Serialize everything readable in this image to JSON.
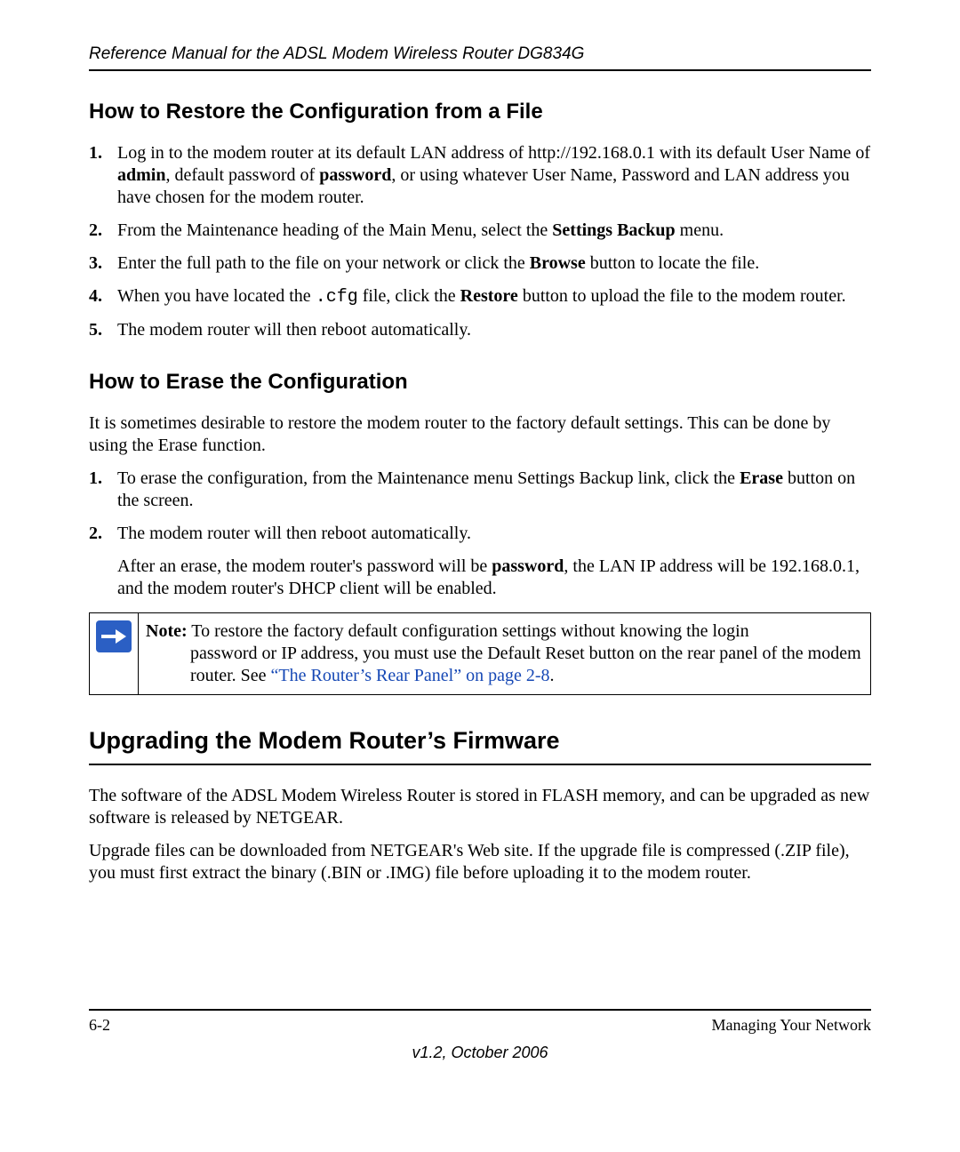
{
  "header": {
    "running_title": "Reference Manual for the ADSL Modem Wireless Router DG834G"
  },
  "section_restore": {
    "title": "How to Restore the Configuration from a File",
    "steps": [
      {
        "num": "1.",
        "pre": "Log in to the modem router at its default LAN address of http://192.168.0.1 with its default User Name of ",
        "b1": "admin",
        "mid": ", default password of ",
        "b2": "password",
        "post": ", or using whatever User Name, Password and LAN address you have chosen for the modem router."
      },
      {
        "num": "2.",
        "pre": "From the Maintenance heading of the Main Menu, select the ",
        "b1": "Settings Backup",
        "post": " menu."
      },
      {
        "num": "3.",
        "pre": "Enter the full path to the file on your network or click the ",
        "b1": "Browse",
        "post": " button to locate the file."
      },
      {
        "num": "4.",
        "pre": "When you have located the ",
        "mono": ".cfg",
        "mid": " file, click the ",
        "b1": "Restore",
        "post": " button to upload the file to the modem router."
      },
      {
        "num": "5.",
        "pre": "The modem router will then reboot automatically."
      }
    ]
  },
  "section_erase": {
    "title": "How to Erase the Configuration",
    "intro": "It is sometimes desirable to restore the modem router to the factory default settings. This can be done by using the Erase function.",
    "steps": [
      {
        "num": "1.",
        "pre": "To erase the configuration, from the Maintenance menu Settings Backup link, click the ",
        "b1": "Erase",
        "post": " button on the screen."
      },
      {
        "num": "2.",
        "pre": "The modem router will then reboot automatically."
      }
    ],
    "after_pre": "After an erase, the modem router's password will be ",
    "after_b": "password",
    "after_post": ", the LAN IP address will be 192.168.0.1, and the modem router's DHCP client will be enabled."
  },
  "note": {
    "label": "Note:",
    "line1": " To restore the factory default configuration settings without knowing the login",
    "line2a": "password or IP address, you must use the Default Reset button on the rear panel of the modem router. See ",
    "xref": "“The Router’s Rear Panel” on page 2-8",
    "line2b": "."
  },
  "section_upgrade": {
    "title": "Upgrading the Modem Router’s Firmware",
    "p1": "The software of the ADSL Modem Wireless Router is stored in FLASH memory, and can be upgraded as new software is released by NETGEAR.",
    "p2": "Upgrade files can be downloaded from NETGEAR's Web site. If the upgrade file is compressed (.ZIP file), you must first extract the binary (.BIN or .IMG) file before uploading it to the modem router."
  },
  "footer": {
    "page_num": "6-2",
    "section_title": "Managing Your Network",
    "version": "v1.2, October 2006"
  }
}
